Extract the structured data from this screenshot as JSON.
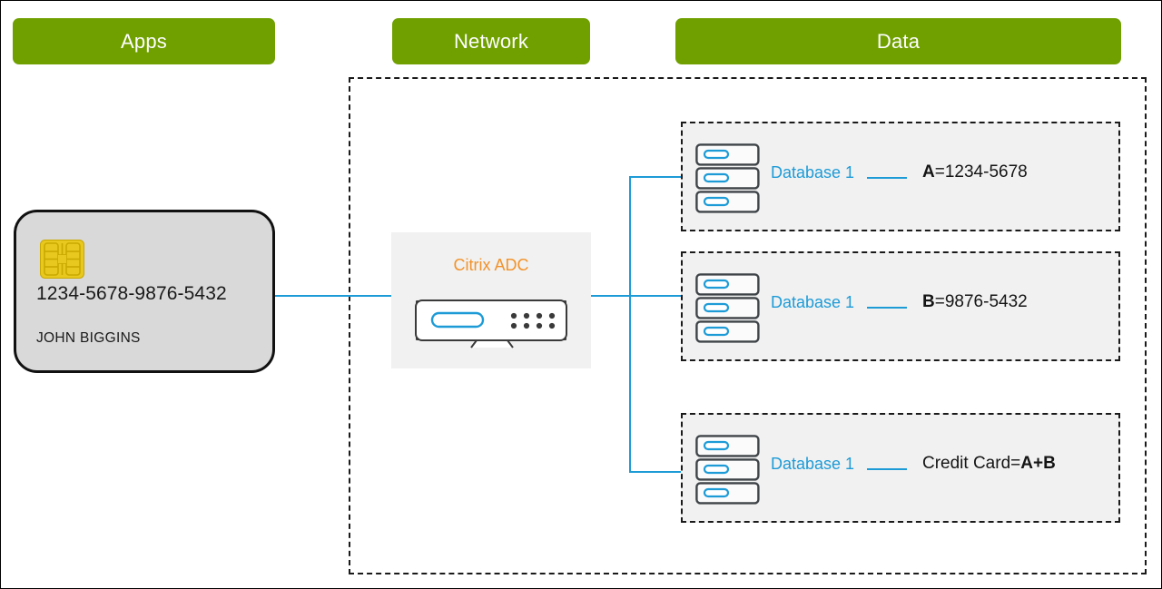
{
  "zones": [
    {
      "id": "apps",
      "label": "Apps"
    },
    {
      "id": "network",
      "label": "Network"
    },
    {
      "id": "data",
      "label": "Data"
    }
  ],
  "card": {
    "number": "1234-5678-9876-5432",
    "holder": "JOHN BIGGINS",
    "chip_icon": "emv-chip-icon",
    "background": "#d9d9d9",
    "border_color": "#111111",
    "chip_color": "#e8c81e"
  },
  "appliance": {
    "label": "Citrix ADC",
    "label_color": "#f2922a",
    "icon": "network-appliance-icon",
    "panel_background": "#f1f1f1"
  },
  "databases": [
    {
      "icon": "server-stack-icon",
      "name": "Database 1",
      "value_prefix": "A",
      "value_separator": "=",
      "value": "1234-5678",
      "value_suffix": ""
    },
    {
      "icon": "server-stack-icon",
      "name": "Database 1",
      "value_prefix": "B",
      "value_separator": "=",
      "value": "9876-5432",
      "value_suffix": ""
    },
    {
      "icon": "server-stack-icon",
      "name": "Database 1",
      "value_prefix": "Credit Card",
      "value_separator": "=",
      "value": "A+B",
      "value_suffix": ""
    }
  ],
  "colors": {
    "zone_header_green": "#6fa000",
    "link_blue": "#1d9bd7",
    "database_label_blue": "#1d9bd7",
    "dashed_border": "#1a1a1a",
    "panel_gray": "#f1f1f1"
  }
}
